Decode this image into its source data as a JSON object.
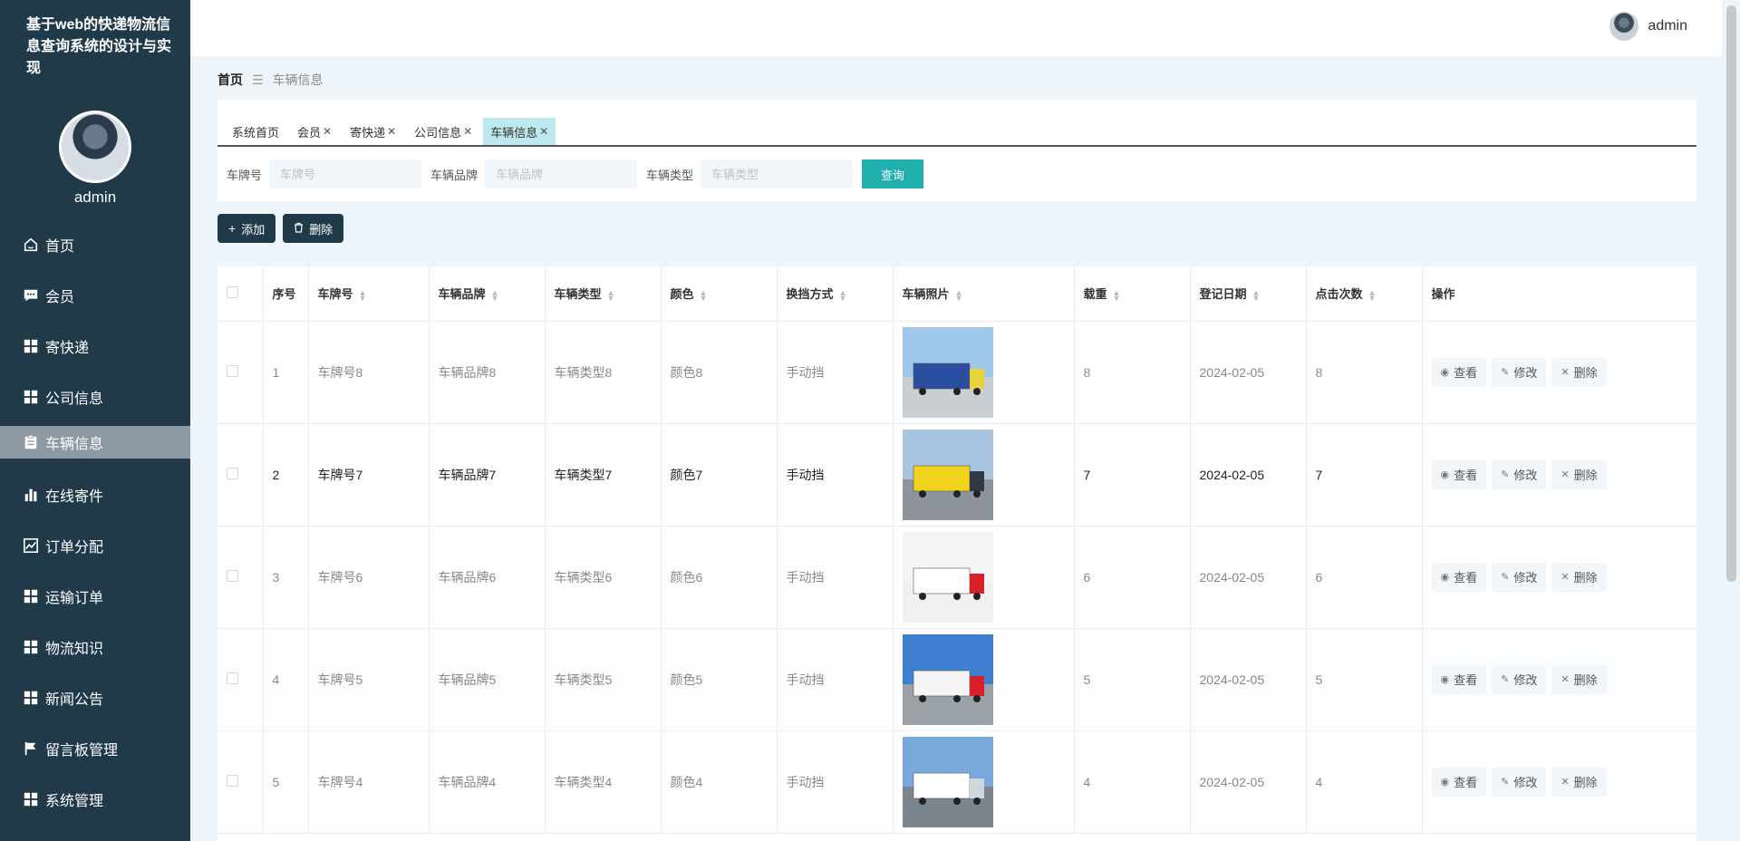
{
  "app": {
    "title": "基于web的快递物流信息查询系统的设计与实现"
  },
  "sidebar": {
    "username": "admin",
    "items": [
      {
        "label": "首页",
        "icon": "home-icon"
      },
      {
        "label": "会员",
        "icon": "chat-icon"
      },
      {
        "label": "寄快递",
        "icon": "grid-icon"
      },
      {
        "label": "公司信息",
        "icon": "grid-icon"
      },
      {
        "label": "车辆信息",
        "icon": "clipboard-icon",
        "active": true
      },
      {
        "label": "在线寄件",
        "icon": "bar-chart-icon"
      },
      {
        "label": "订单分配",
        "icon": "line-chart-icon"
      },
      {
        "label": "运输订单",
        "icon": "grid-icon"
      },
      {
        "label": "物流知识",
        "icon": "grid-icon"
      },
      {
        "label": "新闻公告",
        "icon": "grid-icon"
      },
      {
        "label": "留言板管理",
        "icon": "flag-icon"
      },
      {
        "label": "系统管理",
        "icon": "grid-icon"
      }
    ]
  },
  "header": {
    "username": "admin"
  },
  "breadcrumb": {
    "home": "首页",
    "separator": "☰",
    "current": "车辆信息"
  },
  "tabs": [
    {
      "label": "系统首页",
      "closable": false
    },
    {
      "label": "会员",
      "closable": true
    },
    {
      "label": "寄快递",
      "closable": true
    },
    {
      "label": "公司信息",
      "closable": true
    },
    {
      "label": "车辆信息",
      "closable": true,
      "active": true
    }
  ],
  "search": {
    "plate_label": "车牌号",
    "plate_placeholder": "车牌号",
    "brand_label": "车辆品牌",
    "brand_placeholder": "车辆品牌",
    "type_label": "车辆类型",
    "type_placeholder": "车辆类型",
    "button": "查询"
  },
  "actions": {
    "add": "添加",
    "delete": "删除"
  },
  "table": {
    "columns": [
      "序号",
      "车牌号",
      "车辆品牌",
      "车辆类型",
      "颜色",
      "换挡方式",
      "车辆照片",
      "载重",
      "登记日期",
      "点击次数",
      "操作"
    ],
    "row_actions": {
      "view": "查看",
      "edit": "修改",
      "delete": "删除"
    },
    "rows": [
      {
        "no": "1",
        "plate": "车牌号8",
        "brand": "车辆品牌8",
        "type": "车辆类型8",
        "color": "颜色8",
        "gear": "手动挡",
        "load": "8",
        "date": "2024-02-05",
        "clicks": "8"
      },
      {
        "no": "2",
        "plate": "车牌号7",
        "brand": "车辆品牌7",
        "type": "车辆类型7",
        "color": "颜色7",
        "gear": "手动挡",
        "load": "7",
        "date": "2024-02-05",
        "clicks": "7"
      },
      {
        "no": "3",
        "plate": "车牌号6",
        "brand": "车辆品牌6",
        "type": "车辆类型6",
        "color": "颜色6",
        "gear": "手动挡",
        "load": "6",
        "date": "2024-02-05",
        "clicks": "6"
      },
      {
        "no": "4",
        "plate": "车牌号5",
        "brand": "车辆品牌5",
        "type": "车辆类型5",
        "color": "颜色5",
        "gear": "手动挡",
        "load": "5",
        "date": "2024-02-05",
        "clicks": "5"
      },
      {
        "no": "5",
        "plate": "车牌号4",
        "brand": "车辆品牌4",
        "type": "车辆类型4",
        "color": "颜色4",
        "gear": "手动挡",
        "load": "4",
        "date": "2024-02-05",
        "clicks": "4"
      }
    ]
  },
  "colors": {
    "sidebar_bg": "#203a4a",
    "accent": "#1fb0ae",
    "active_tab": "#bde8ee",
    "page_bg": "#edf5fb"
  }
}
